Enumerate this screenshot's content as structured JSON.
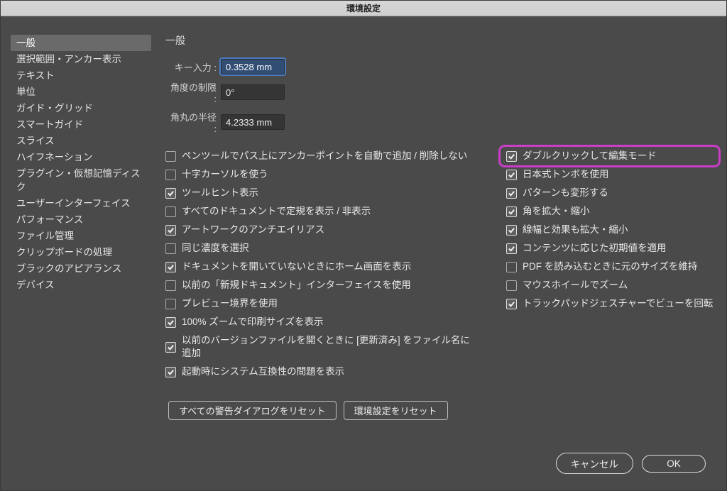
{
  "title": "環境設定",
  "sidebar": {
    "items": [
      "一般",
      "選択範囲・アンカー表示",
      "テキスト",
      "単位",
      "ガイド・グリッド",
      "スマートガイド",
      "スライス",
      "ハイフネーション",
      "プラグイン・仮想記憶ディスク",
      "ユーザーインターフェイス",
      "パフォーマンス",
      "ファイル管理",
      "クリップボードの処理",
      "ブラックのアピアランス",
      "デバイス"
    ],
    "selected_index": 0
  },
  "main": {
    "heading": "一般",
    "fields": {
      "key_input": {
        "label": "キー入力 :",
        "value": "0.3528 mm"
      },
      "angle_limit": {
        "label": "角度の制限 :",
        "value": "0°"
      },
      "corner_radius": {
        "label": "角丸の半径 :",
        "value": "4.2333 mm"
      }
    },
    "checks_left": [
      {
        "label": "ペンツールでパス上にアンカーポイントを自動で追加 / 削除しない",
        "checked": false
      },
      {
        "label": "十字カーソルを使う",
        "checked": false
      },
      {
        "label": "ツールヒント表示",
        "checked": true
      },
      {
        "label": "すべてのドキュメントで定規を表示 / 非表示",
        "checked": false
      },
      {
        "label": "アートワークのアンチエイリアス",
        "checked": true
      },
      {
        "label": "同じ濃度を選択",
        "checked": false
      },
      {
        "label": "ドキュメントを開いていないときにホーム画面を表示",
        "checked": true
      },
      {
        "label": "以前の「新規ドキュメント」インターフェイスを使用",
        "checked": false
      },
      {
        "label": "プレビュー境界を使用",
        "checked": false
      },
      {
        "label": "100% ズームで印刷サイズを表示",
        "checked": true
      },
      {
        "label": "以前のバージョンファイルを開くときに [更新済み] をファイル名に追加",
        "checked": true
      },
      {
        "label": "起動時にシステム互換性の問題を表示",
        "checked": true
      }
    ],
    "checks_right": [
      {
        "label": "ダブルクリックして編集モード",
        "checked": true,
        "highlight": true
      },
      {
        "label": "日本式トンボを使用",
        "checked": true
      },
      {
        "label": "パターンも変形する",
        "checked": true
      },
      {
        "label": "角を拡大・縮小",
        "checked": true
      },
      {
        "label": "線幅と効果も拡大・縮小",
        "checked": true
      },
      {
        "label": "コンテンツに応じた初期値を適用",
        "checked": true
      },
      {
        "label": "PDF を読み込むときに元のサイズを維持",
        "checked": false
      },
      {
        "label": "マウスホイールでズーム",
        "checked": false
      },
      {
        "label": "トラックパッドジェスチャーでビューを回転",
        "checked": true
      }
    ],
    "reset_buttons": {
      "reset_warnings": "すべての警告ダイアログをリセット",
      "reset_prefs": "環境設定をリセット"
    }
  },
  "footer": {
    "cancel": "キャンセル",
    "ok": "OK"
  }
}
